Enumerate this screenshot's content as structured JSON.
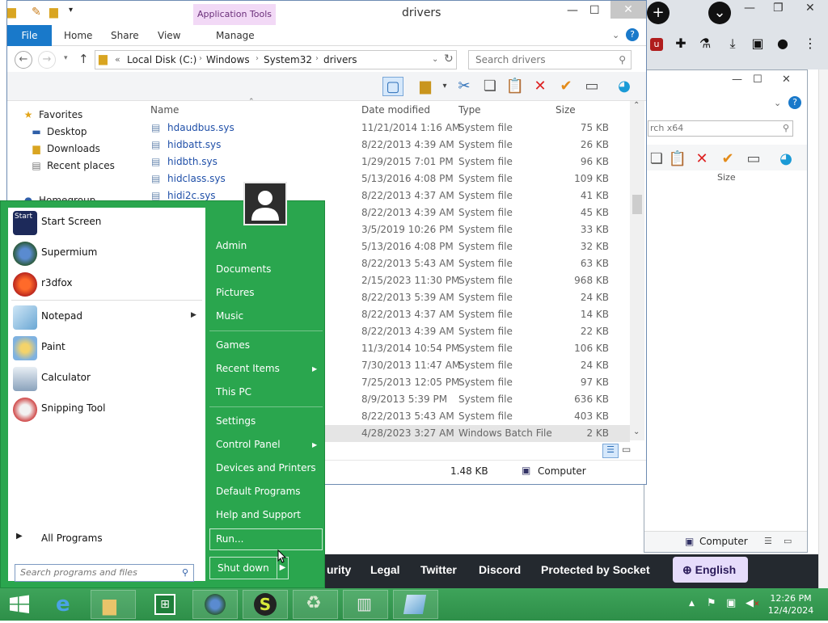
{
  "browser": {
    "ext_icons": [
      "ublock-icon",
      "puzzle-icon",
      "flask-icon",
      "download-icon",
      "sidebar-icon",
      "profile-icon",
      "more-icon"
    ],
    "footer_links": [
      "urity",
      "Legal",
      "Twitter",
      "Discord",
      "Protected by Socket"
    ],
    "language_button": "English"
  },
  "window2": {
    "search_placeholder": "rch x64",
    "column_size": "Size",
    "status_computer": "Computer"
  },
  "explorer": {
    "app_tools": "Application Tools",
    "title": "drivers",
    "tabs": {
      "file": "File",
      "home": "Home",
      "share": "Share",
      "view": "View",
      "manage": "Manage"
    },
    "breadcrumb": [
      "Local Disk (C:)",
      "Windows",
      "System32",
      "drivers"
    ],
    "search_placeholder": "Search drivers",
    "nav": {
      "favorites": "Favorites",
      "desktop": "Desktop",
      "downloads": "Downloads",
      "recent": "Recent places",
      "homegroup": "Homegroup"
    },
    "columns": {
      "name": "Name",
      "date": "Date modified",
      "type": "Type",
      "size": "Size"
    },
    "files": [
      {
        "name": "hdaudbus.sys",
        "date": "11/21/2014 1:16 AM",
        "type": "System file",
        "size": "75 KB"
      },
      {
        "name": "hidbatt.sys",
        "date": "8/22/2013 4:39 AM",
        "type": "System file",
        "size": "26 KB"
      },
      {
        "name": "hidbth.sys",
        "date": "1/29/2015 7:01 PM",
        "type": "System file",
        "size": "96 KB"
      },
      {
        "name": "hidclass.sys",
        "date": "5/13/2016 4:08 PM",
        "type": "System file",
        "size": "109 KB"
      },
      {
        "name": "hidi2c.sys",
        "date": "8/22/2013 4:37 AM",
        "type": "System file",
        "size": "41 KB"
      },
      {
        "name": "",
        "date": "8/22/2013 4:39 AM",
        "type": "System file",
        "size": "45 KB"
      },
      {
        "name": "",
        "date": "3/5/2019 10:26 PM",
        "type": "System file",
        "size": "33 KB"
      },
      {
        "name": "",
        "date": "5/13/2016 4:08 PM",
        "type": "System file",
        "size": "32 KB"
      },
      {
        "name": "",
        "date": "8/22/2013 5:43 AM",
        "type": "System file",
        "size": "63 KB"
      },
      {
        "name": "",
        "date": "2/15/2023 11:30 PM",
        "type": "System file",
        "size": "968 KB"
      },
      {
        "name": "",
        "date": "8/22/2013 5:39 AM",
        "type": "System file",
        "size": "24 KB"
      },
      {
        "name": "",
        "date": "8/22/2013 4:37 AM",
        "type": "System file",
        "size": "14 KB"
      },
      {
        "name": "",
        "date": "8/22/2013 4:39 AM",
        "type": "System file",
        "size": "22 KB"
      },
      {
        "name": "",
        "date": "11/3/2014 10:54 PM",
        "type": "System file",
        "size": "106 KB"
      },
      {
        "name": "",
        "date": "7/30/2013 11:47 AM",
        "type": "System file",
        "size": "24 KB"
      },
      {
        "name": "",
        "date": "7/25/2013 12:05 PM",
        "type": "System file",
        "size": "97 KB"
      },
      {
        "name": "",
        "date": "8/9/2013 5:39 PM",
        "type": "System file",
        "size": "636 KB"
      },
      {
        "name": "",
        "date": "8/22/2013 5:43 AM",
        "type": "System file",
        "size": "403 KB"
      },
      {
        "name": "",
        "date": "4/28/2023 3:27 AM",
        "type": "Windows Batch File",
        "size": "2 KB"
      }
    ],
    "status": {
      "size": "1.48 KB",
      "computer": "Computer"
    }
  },
  "startmenu": {
    "programs": [
      {
        "label": "Start Screen",
        "icon": "start-screen-icon"
      },
      {
        "label": "Supermium",
        "icon": "supermium-icon"
      },
      {
        "label": "r3dfox",
        "icon": "r3dfox-icon"
      },
      {
        "label": "Notepad",
        "icon": "notepad-icon"
      },
      {
        "label": "Paint",
        "icon": "paint-icon"
      },
      {
        "label": "Calculator",
        "icon": "calculator-icon"
      },
      {
        "label": "Snipping Tool",
        "icon": "snipping-tool-icon"
      }
    ],
    "start_tile_text": "Start",
    "all_programs": "All Programs",
    "search_placeholder": "Search programs and files",
    "right": {
      "user": "Admin",
      "documents": "Documents",
      "pictures": "Pictures",
      "music": "Music",
      "games": "Games",
      "recent_items": "Recent Items",
      "this_pc": "This PC",
      "settings": "Settings",
      "control_panel": "Control Panel",
      "devices": "Devices and Printers",
      "default_programs": "Default Programs",
      "help": "Help and Support",
      "run": "Run...",
      "shutdown": "Shut down"
    }
  },
  "taskbar": {
    "clock_time": "12:26 PM",
    "clock_date": "12/4/2024"
  },
  "colors": {
    "start_green": "#2aa64e",
    "taskbar_green": "#3ea45a",
    "ribbon_blue": "#1979ca",
    "app_tools_pink": "#f2d9f6"
  }
}
